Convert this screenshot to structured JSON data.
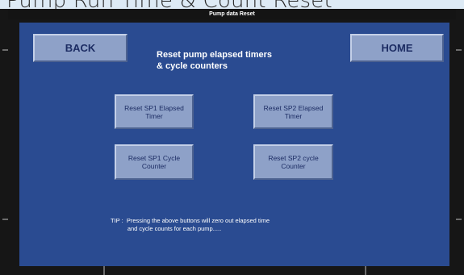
{
  "page_caption": "Pump Run Time & Count Reset",
  "window_title": "Pump data Reset",
  "heading": "Reset pump elapsed timers\n& cycle counters",
  "nav": {
    "back_label": "BACK",
    "home_label": "HOME"
  },
  "reset_buttons": [
    {
      "label": "Reset SP1 Elapsed\nTimer"
    },
    {
      "label": "Reset SP2 Elapsed\nTimer"
    },
    {
      "label": "Reset SP1 Cycle\nCounter"
    },
    {
      "label": "Reset SP2 cycle\nCounter"
    }
  ],
  "tip": "TIP :  Pressing the above buttons will zero out elapsed time\n          and cycle counts for each pump.....",
  "colors": {
    "panel": "#2a4b91",
    "button_face": "#8ea1c8",
    "button_text": "#1c2c63",
    "frame": "#161616"
  }
}
